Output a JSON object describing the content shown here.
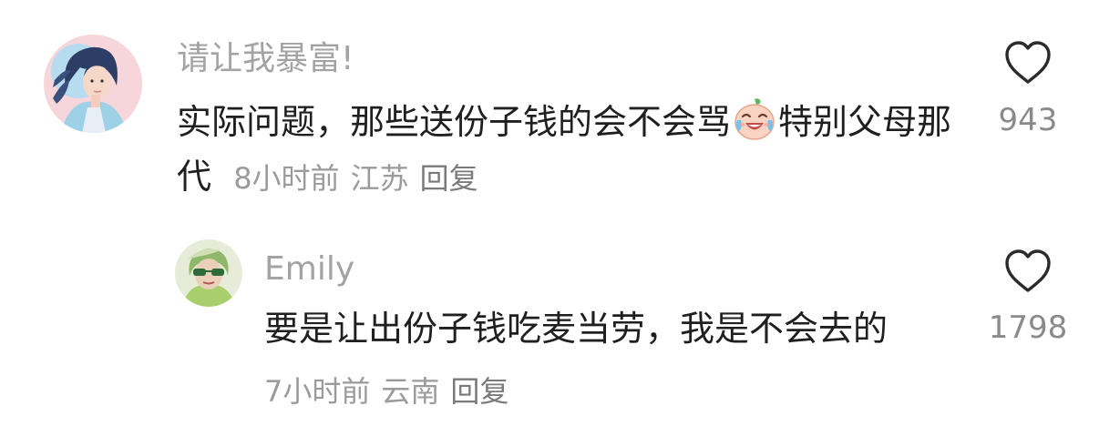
{
  "comments": [
    {
      "username": "请让我暴富!",
      "text_before_emoji": "实际问题，那些送份子钱的会不会骂",
      "emoji": "crying-laughing-emoji",
      "text_after_emoji": "特别父母那代",
      "time": "8小时前",
      "location": "江苏",
      "reply_label": "回复",
      "like_icon": "heart-outline-icon",
      "like_count": "943"
    },
    {
      "username": "Emily",
      "text": "要是让出份子钱吃麦当劳，我是不会去的",
      "time": "7小时前",
      "location": "云南",
      "reply_label": "回复",
      "like_icon": "heart-outline-icon",
      "like_count": "1798"
    }
  ],
  "colors": {
    "username": "#a3a3a3",
    "body_text": "#1f1f1f",
    "meta_text": "#9b9b9b",
    "like_count": "#8a8a8a"
  }
}
